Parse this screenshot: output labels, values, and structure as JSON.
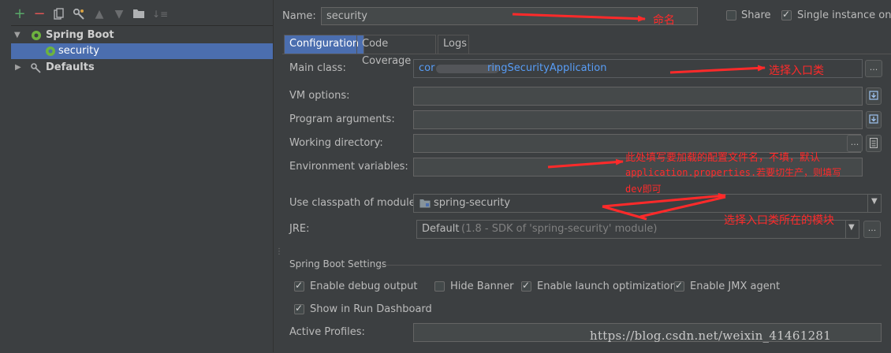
{
  "toolbar": {
    "icons": [
      "add-icon",
      "remove-icon",
      "copy-icon",
      "wrench-icon",
      "arrow-up-icon",
      "arrow-down-icon",
      "folder-icon",
      "sort-icon"
    ]
  },
  "tree": {
    "spring_boot": "Spring Boot",
    "security": "security",
    "defaults": "Defaults"
  },
  "header": {
    "name_label": "Name:",
    "name_value": "security",
    "share_label": "Share",
    "single_instance_label": "Single instance only"
  },
  "tabs": [
    "Configuration",
    "Code Coverage",
    "Logs"
  ],
  "form": {
    "main_class_label": "Main class:",
    "main_class_value_start": "cor",
    "main_class_value_end": "ringSecurityApplication",
    "vm_options_label": "VM options:",
    "program_args_label": "Program arguments:",
    "working_dir_label": "Working directory:",
    "env_vars_label": "Environment variables:",
    "classpath_label": "Use classpath of module:",
    "classpath_value": "spring-security",
    "jre_label": "JRE:",
    "jre_value_main": "Default",
    "jre_value_detail": "(1.8 - SDK of 'spring-security' module)",
    "settings_header": "Spring Boot Settings",
    "enable_debug": "Enable debug output",
    "hide_banner": "Hide Banner",
    "enable_launch_opt": "Enable launch optimization",
    "enable_jmx": "Enable JMX agent",
    "show_dashboard": "Show in Run Dashboard",
    "active_profiles_label": "Active Profiles:",
    "ellipsis": "..."
  },
  "annotations": {
    "name": "命名",
    "main_class": "选择入口类",
    "env_line1": "此处填写要加载的配置文件名，不填，默认",
    "env_line2": "application.properties.若要切生产，则填写",
    "env_line3": "dev即可",
    "module": "选择入口类所在的模块"
  },
  "watermark": "https://blog.csdn.net/weixin_41461281",
  "colors": {
    "background": "#3c3f41",
    "selection": "#4b6eaf",
    "annotation": "#ff2a2a",
    "link_text": "#589df6"
  }
}
